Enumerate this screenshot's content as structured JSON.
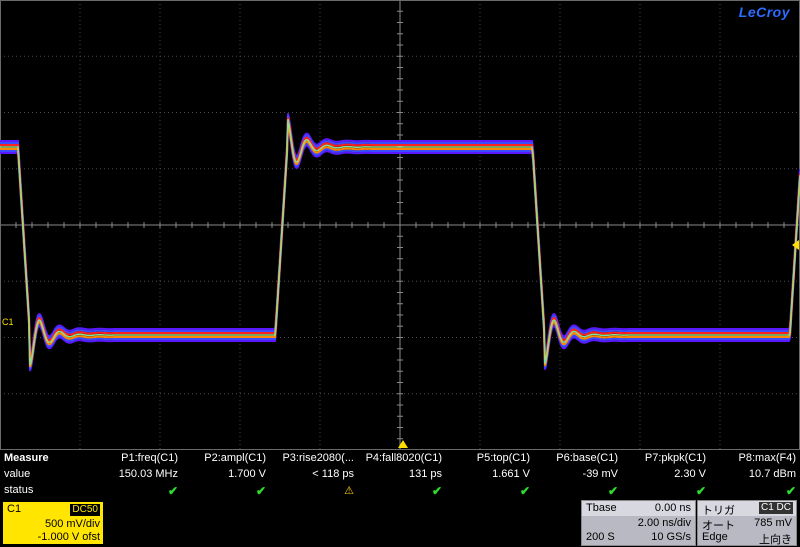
{
  "brand": "LeCroy",
  "channel_marker": "C1",
  "colors": {
    "trace_yellow": "#ffdf00",
    "grid": "#5a5a5a",
    "check": "#2ee02e"
  },
  "measure": {
    "header": "Measure",
    "value_label": "value",
    "status_label": "status",
    "params": [
      {
        "name": "P1:freq(C1)",
        "value": "150.03 MHz",
        "status": "ok"
      },
      {
        "name": "P2:ampl(C1)",
        "value": "1.700 V",
        "status": "ok"
      },
      {
        "name": "P3:rise2080(...",
        "value": "< 118 ps",
        "status": "warn"
      },
      {
        "name": "P4:fall8020(C1)",
        "value": "131 ps",
        "status": "ok"
      },
      {
        "name": "P5:top(C1)",
        "value": "1.661 V",
        "status": "ok"
      },
      {
        "name": "P6:base(C1)",
        "value": "-39 mV",
        "status": "ok"
      },
      {
        "name": "P7:pkpk(C1)",
        "value": "2.30 V",
        "status": "ok"
      },
      {
        "name": "P8:max(F4)",
        "value": "10.7 dBm",
        "status": "ok"
      }
    ]
  },
  "channel": {
    "name": "C1",
    "coupling": "DC50",
    "vdiv": "500 mV/div",
    "offset": "-1.000 V ofst"
  },
  "timebase": {
    "title": "Tbase",
    "delay": "0.00 ns",
    "tdiv": "2.00 ns/div",
    "samples": "200 S",
    "rate": "10 GS/s"
  },
  "trigger": {
    "title": "トリガ",
    "source": "C1 DC",
    "mode": "オート",
    "level": "785 mV",
    "type": "Edge",
    "slope": "上向き"
  },
  "waveform": {
    "period_divs": 6.665,
    "high_volts": 1.661,
    "low_volts": -0.039,
    "volts_per_div": 0.5,
    "offset_volts": -1.0
  }
}
